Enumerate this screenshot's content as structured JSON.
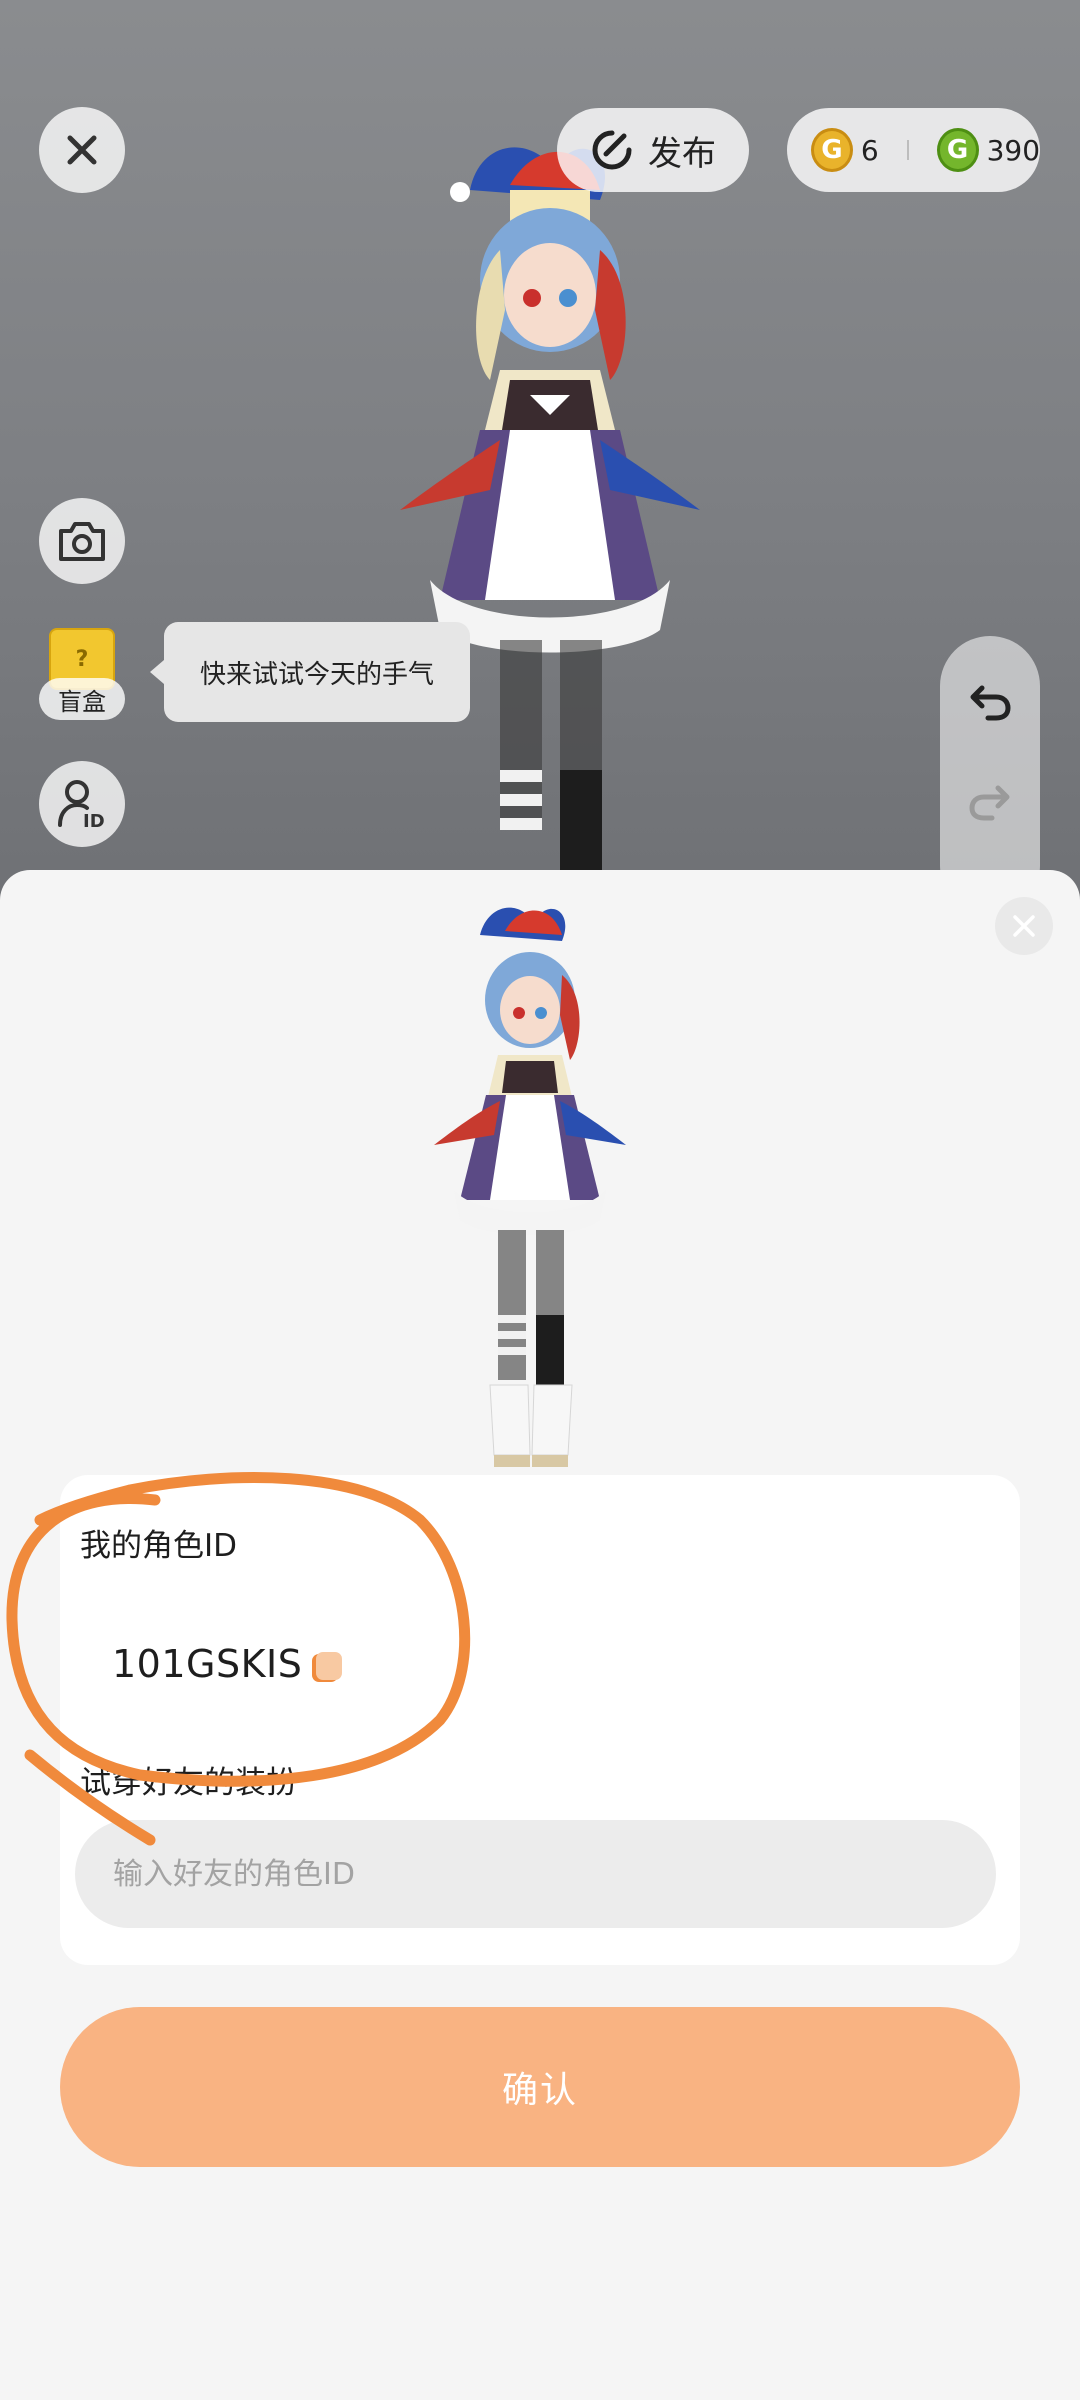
{
  "topbar": {
    "publish_label": "发布",
    "gold_coins": "6",
    "green_coins": "390",
    "gold_coin_icon_letter": "G",
    "green_coin_icon_letter": "G"
  },
  "left_tools": {
    "blindbox_label": "盲盒",
    "blindbox_icon_text": "?",
    "tooltip_text": "快来试试今天的手气",
    "id_badge": "ID"
  },
  "sheet": {
    "my_id_label": "我的角色ID",
    "my_id_value": "101GSKIS",
    "tryon_label": "试穿好友的装扮",
    "friend_id_placeholder": "输入好友的角色ID",
    "confirm_label": "确认"
  },
  "colors": {
    "accent_orange": "#f9b382",
    "annotation_orange": "#f08a3c",
    "gold_coin": "#e9b32b",
    "green_coin": "#74b62c"
  },
  "icons": [
    "close-icon",
    "publish-icon",
    "gold-coin-icon",
    "green-coin-icon",
    "camera-icon",
    "blindbox-icon",
    "id-icon",
    "undo-icon",
    "redo-icon",
    "copy-icon"
  ]
}
